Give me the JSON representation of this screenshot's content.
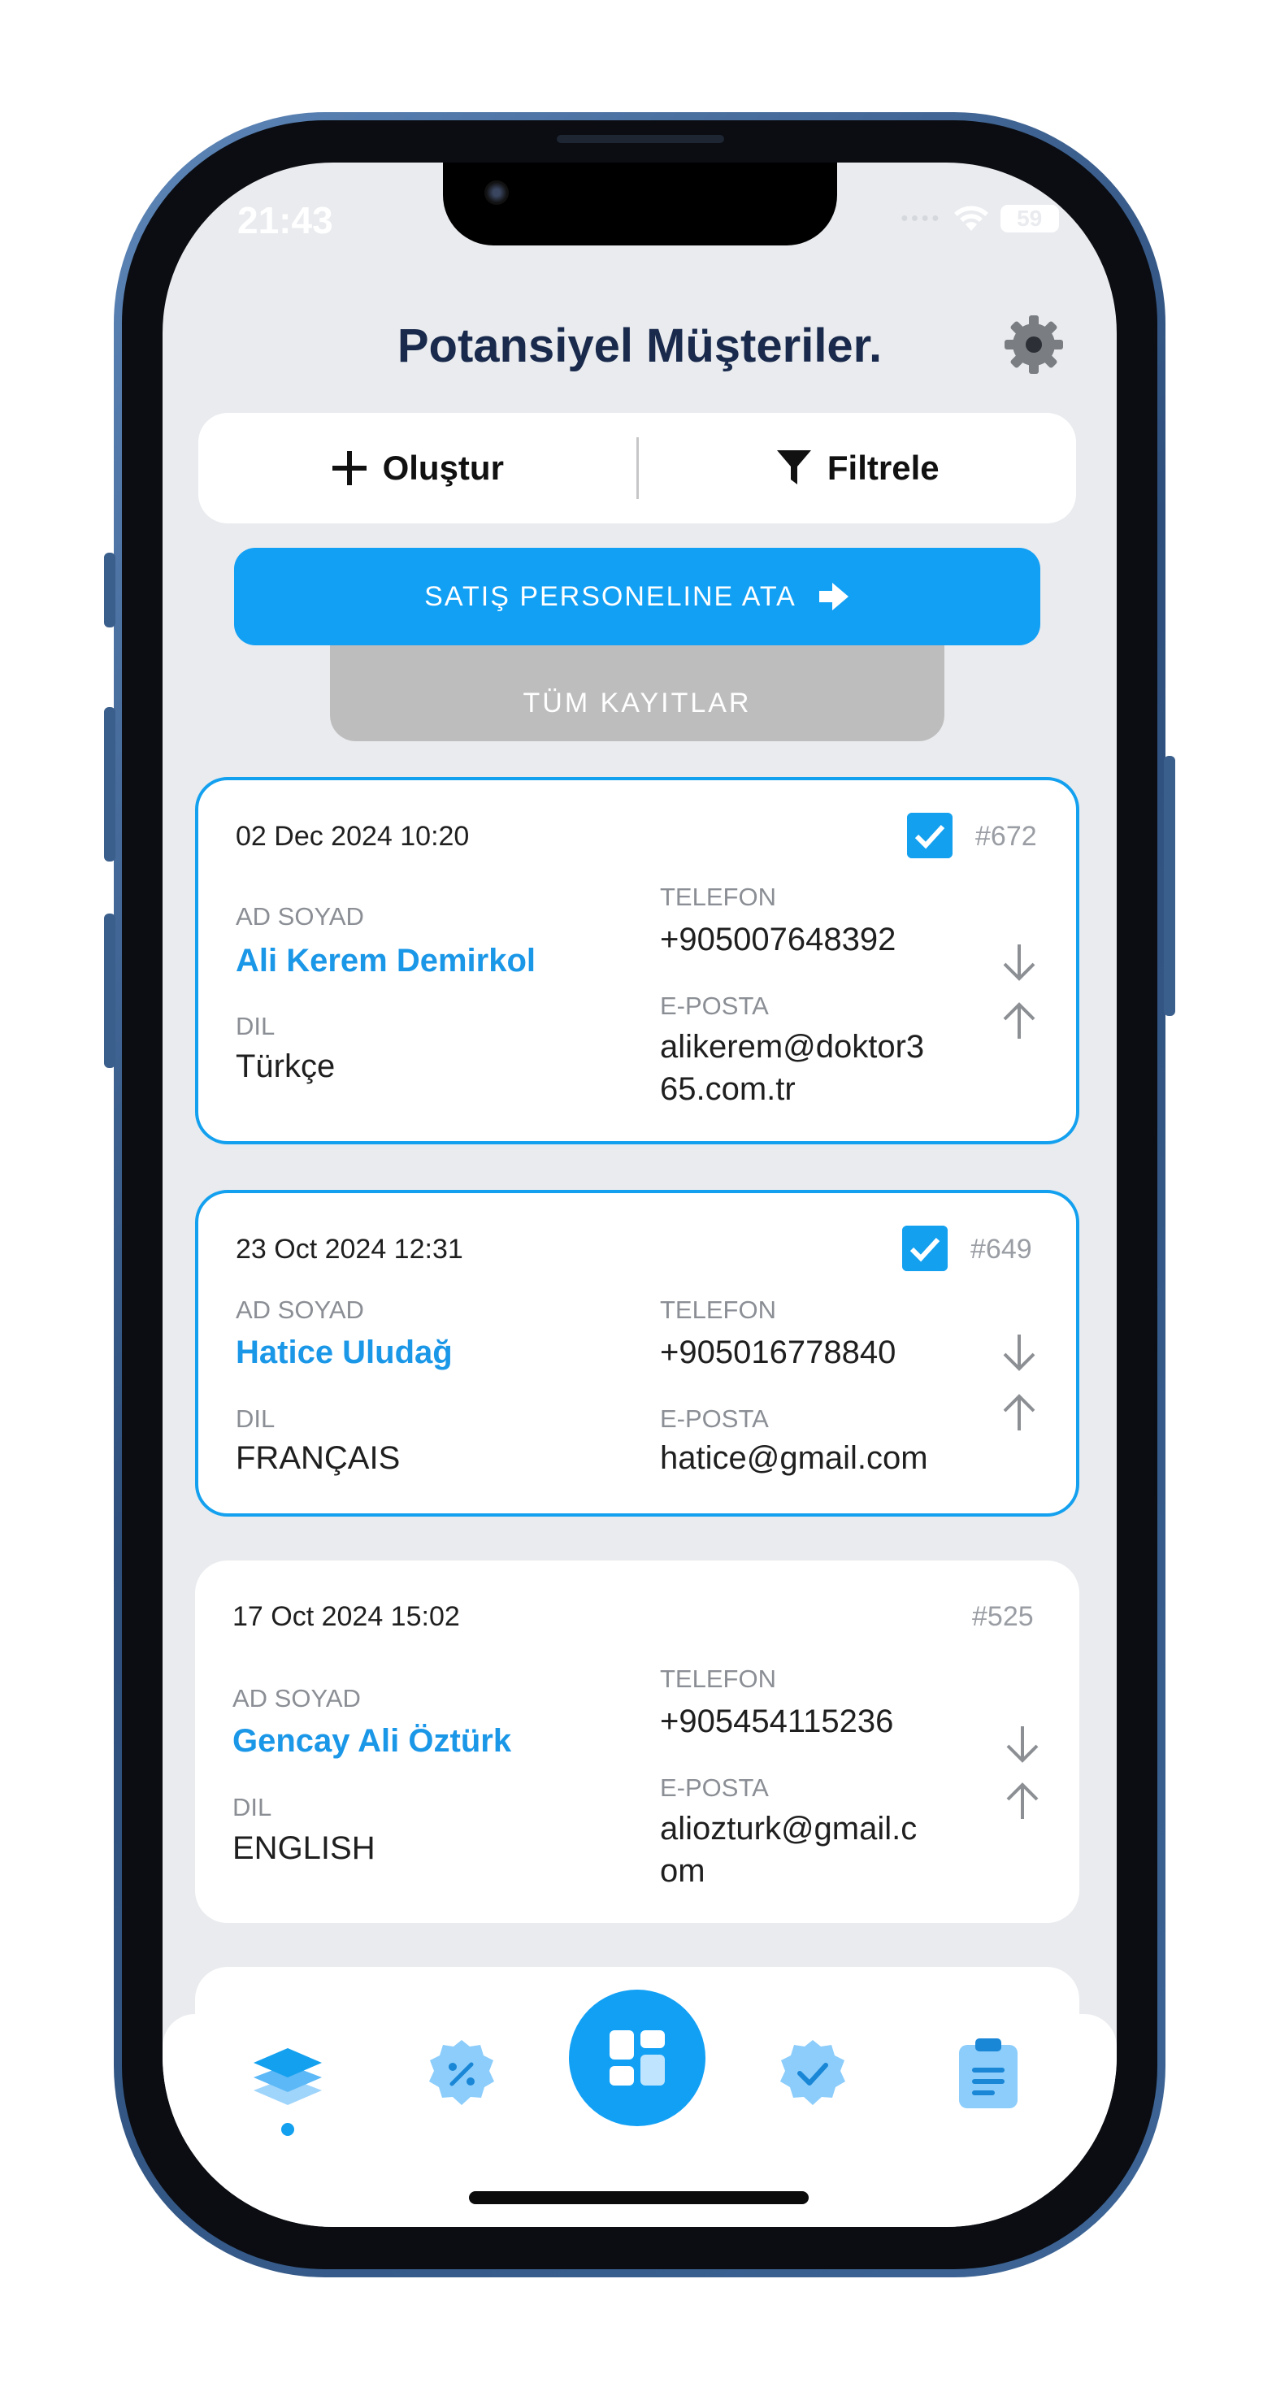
{
  "status": {
    "time": "21:43",
    "battery": "59"
  },
  "header": {
    "title": "Potansiyel Müşteriler."
  },
  "actions": {
    "create_label": "Oluştur",
    "filter_label": "Filtrele"
  },
  "assign": {
    "label": "SATIŞ PERSONELINE ATA"
  },
  "records": {
    "label": "TÜM KAYITLAR"
  },
  "field_labels": {
    "name": "AD SOYAD",
    "language": "DIL",
    "phone": "TELEFON",
    "email": "E-POSTA"
  },
  "cards": [
    {
      "date": "02 Dec 2024 10:20",
      "id": "#672",
      "selected": true,
      "name": "Ali Kerem Demirkol",
      "language": "Türkçe",
      "phone": "+905007648392",
      "email_line1": "alikerem@doktor3",
      "email_line2": "65.com.tr"
    },
    {
      "date": "23 Oct 2024 12:31",
      "id": "#649",
      "selected": true,
      "name": "Hatice Uludağ",
      "language": "FRANÇAIS",
      "phone": "+905016778840",
      "email_line1": "hatice@gmail.com",
      "email_line2": ""
    },
    {
      "date": "17 Oct 2024 15:02",
      "id": "#525",
      "selected": false,
      "name": "Gencay Ali Öztürk",
      "language": "ENGLISH",
      "phone": "+905454115236",
      "email_line1": "aliozturk@gmail.c",
      "email_line2": "om"
    }
  ],
  "colors": {
    "accent": "#12a0f5",
    "title": "#1a2a4c",
    "background": "#e9ebee",
    "frame": "#3d6596"
  },
  "nav": {
    "icons": [
      "layers-icon",
      "discount-badge-icon",
      "dashboard-icon",
      "verified-badge-icon",
      "clipboard-icon"
    ],
    "active_index": 0
  }
}
